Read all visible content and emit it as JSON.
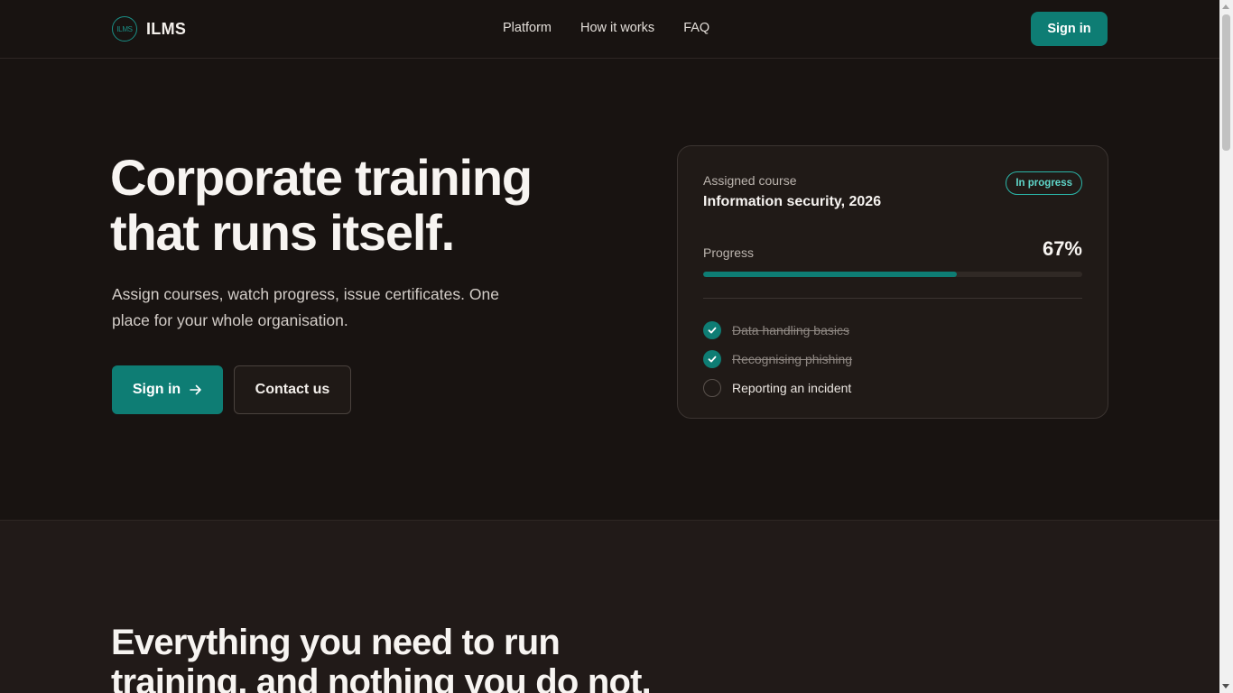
{
  "brand": {
    "logo_text": "ILMS",
    "name": "ILMS"
  },
  "nav": {
    "items": [
      "Platform",
      "How it works",
      "FAQ"
    ]
  },
  "header": {
    "signin_label": "Sign in"
  },
  "hero": {
    "title_line1": "Corporate training",
    "title_line2": "that runs itself.",
    "subtitle": "Assign courses, watch progress, issue certificates. One place for your whole organisation.",
    "primary_cta": "Sign in",
    "secondary_cta": "Contact us"
  },
  "card": {
    "eyebrow": "Assigned course",
    "title": "Information security, 2026",
    "badge": "In progress",
    "progress_label": "Progress",
    "progress_text": "67%",
    "progress_fraction": 0.67,
    "items": [
      {
        "label": "Data handling basics",
        "done": true
      },
      {
        "label": "Recognising phishing",
        "done": true
      },
      {
        "label": "Reporting an incident",
        "done": false
      }
    ]
  },
  "section2": {
    "title_line1": "Everything you need to run",
    "title_line2": "training, and nothing you do not."
  },
  "colors": {
    "accent": "#0e7d74",
    "badge": "#2bb5a8",
    "background": "#181311"
  },
  "icons": {
    "check": "check-icon",
    "arrow": "arrow-right-icon"
  }
}
